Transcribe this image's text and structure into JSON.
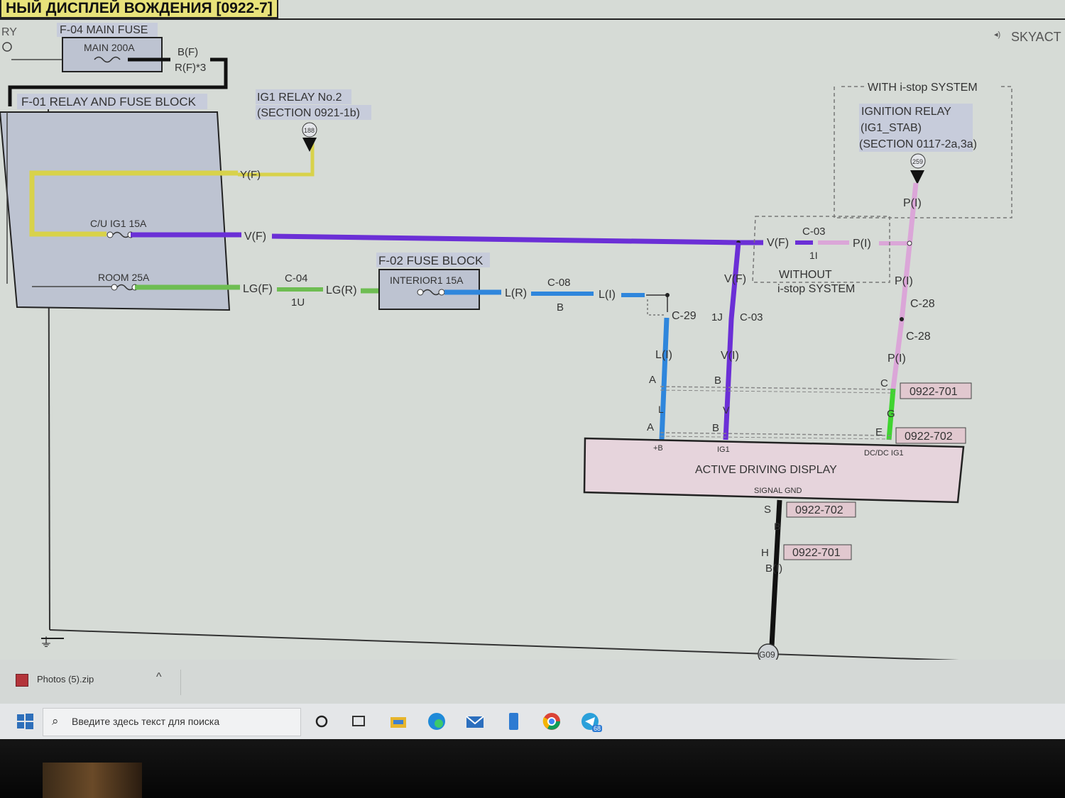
{
  "window_title": "НЫЙ ДИСПЛЕЙ ВОЖДЕНИЯ [0922-7]",
  "header_right": "SKYACT",
  "left_edge_label": "RY",
  "colors": {
    "yellow": "#d8d24a",
    "violet": "#6b2fd6",
    "green": "#6ebd52",
    "blue": "#2f86dc",
    "pink": "#dba6d8",
    "ground_wire": "#111111",
    "harness": "#161616",
    "bright_green": "#3fd430",
    "box_fill": "#bdc3d1",
    "label_fill": "#c7ccdb",
    "ref_fill": "#e1c8cf",
    "display_fill": "#e6d4dc"
  },
  "main_fuse": {
    "section": "F-04 MAIN FUSE",
    "fuse": "MAIN 200A",
    "outputs": [
      "B(F)",
      "R(F)*3"
    ]
  },
  "relay_fuse_block": {
    "section": "F-01 RELAY AND FUSE BLOCK",
    "fuse_ig1": "C/U IG1 15A",
    "fuse_room": "ROOM 25A"
  },
  "ig1_relay": {
    "name": "IG1 RELAY No.2",
    "section": "(SECTION 0921-1b)",
    "node": "188"
  },
  "ignition_relay": {
    "group": "WITH i-stop SYSTEM",
    "name": "IGNITION RELAY",
    "sub": "(IG1_STAB)",
    "section": "(SECTION 0117-2a,3a)",
    "node": "259"
  },
  "without_istop": {
    "line1": "WITHOUT",
    "line2": "i-stop SYSTEM"
  },
  "fuse_block": {
    "section": "F-02 FUSE BLOCK",
    "fuse": "INTERIOR1 15A"
  },
  "wire_labels": {
    "yf": "Y(F)",
    "vf": "V(F)",
    "vf2": "V(F)",
    "vf3": "V(F)",
    "lgf": "LG(F)",
    "lgr": "LG(R)",
    "lr": "L(R)",
    "li": "L(I)",
    "li2": "L(I)",
    "vi": "V(I)",
    "pi": "P(I)",
    "pi2": "P(I)",
    "pi3": "P(I)",
    "pi4": "P(I)",
    "l": "L",
    "v": "V",
    "g": "G",
    "b": "B",
    "bi": "B(I)"
  },
  "connectors": {
    "c04": "C-04",
    "c04_pin": "1U",
    "c08": "C-08",
    "c08_pin": "B",
    "c03_top": "C-03",
    "c03_top_pin": "1I",
    "c03_mid": "C-03",
    "c03_mid_pin": "1J",
    "c29": "C-29",
    "c28a": "C-28",
    "c28b": "C-28",
    "pin_a1": "A",
    "pin_b1": "B",
    "pin_c1": "C",
    "pin_a2": "A",
    "pin_b2": "B",
    "pin_e2": "E",
    "pin_s": "S",
    "pin_h": "H"
  },
  "refs": {
    "r1": "0922-701",
    "r2": "0922-702",
    "r3": "0922-702",
    "r4": "0922-701"
  },
  "display": {
    "name": "ACTIVE DRIVING DISPLAY",
    "pin_b": "+B",
    "pin_ig1": "IG1",
    "pin_dcdc": "DC/DC IG1",
    "pin_gnd": "SIGNAL GND"
  },
  "ground": {
    "point": "G09"
  },
  "download_bar": {
    "file": "Photos (5).zip",
    "chevron": "^"
  },
  "taskbar": {
    "search_placeholder": "Введите здесь текст для поиска",
    "telegram_badge": "68"
  }
}
